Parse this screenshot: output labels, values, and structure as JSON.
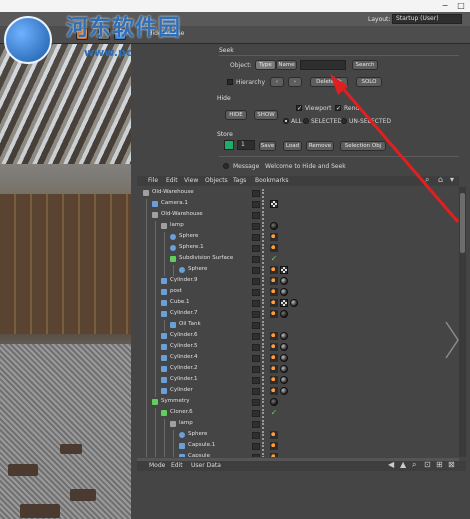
{
  "watermark": {
    "text": "河东软件园",
    "url": "www.pc0359.cn"
  },
  "window": {
    "minimize": "−",
    "maximize": "□"
  },
  "toolbar": {
    "layout_label": "Layout:",
    "layout_value": "Startup (User)",
    "scene_name": "Hide and Se"
  },
  "seek": {
    "group_title": "Seek",
    "object_label": "Object:",
    "type_tab": "Type",
    "name_tab": "Name",
    "search_button": "Search",
    "hierarchy_label": "Hierarchy",
    "prev_button": "‹",
    "next_button": "›",
    "delete_tag_button": "Delete Ta",
    "solo_button": "SOLO"
  },
  "hide": {
    "group_title": "Hide",
    "hide_button": "HIDE",
    "show_button": "SHOW",
    "viewport_label": "Viewport",
    "render_label": "Rend",
    "all_label": "ALL",
    "selected_label": "SELECTED",
    "unselected_label": "UN-SELECTED"
  },
  "store": {
    "group_title": "Store",
    "slot_value": "1",
    "save_button": "Save",
    "load_button": "Load",
    "remove_button": "Remove",
    "selection_button": "Selection Obj"
  },
  "message": {
    "label": "Message",
    "text": "Welcome to Hide and Seek"
  },
  "object_manager": {
    "menus": [
      "File",
      "Edit",
      "View",
      "Objects",
      "Tags",
      "Bookmarks"
    ],
    "rows": [
      {
        "name": "Old-Warehouse",
        "depth": 0,
        "icon": "null",
        "tags": []
      },
      {
        "name": "Camera.1",
        "depth": 1,
        "icon": "camera",
        "tags": [
          "checker"
        ]
      },
      {
        "name": "Old-Warehouse",
        "depth": 1,
        "icon": "null",
        "tags": []
      },
      {
        "name": "lamp",
        "depth": 2,
        "icon": "null",
        "tags": [
          "mat2"
        ]
      },
      {
        "name": "Sphere",
        "depth": 3,
        "icon": "sphere",
        "tags": [
          "phong"
        ]
      },
      {
        "name": "Sphere.1",
        "depth": 3,
        "icon": "sphere",
        "tags": [
          "phong"
        ]
      },
      {
        "name": "Subdivision Surface",
        "depth": 3,
        "icon": "subdiv",
        "tags": [
          "tick"
        ]
      },
      {
        "name": "Sphere",
        "depth": 4,
        "icon": "sphere-gizmo",
        "tags": [
          "phong",
          "checker"
        ]
      },
      {
        "name": "Cylinder.9",
        "depth": 2,
        "icon": "cylinder",
        "tags": [
          "phong",
          "mat"
        ]
      },
      {
        "name": "post",
        "depth": 2,
        "icon": "cylinder",
        "tags": [
          "phong",
          "mat"
        ]
      },
      {
        "name": "Cube.1",
        "depth": 2,
        "icon": "cube",
        "tags": [
          "phong",
          "checker",
          "mat"
        ]
      },
      {
        "name": "Cylinder.7",
        "depth": 2,
        "icon": "cylinder",
        "tags": [
          "phong",
          "mat2"
        ]
      },
      {
        "name": "Oil Tank",
        "depth": 3,
        "icon": "cylinder",
        "tags": []
      },
      {
        "name": "Cylinder.6",
        "depth": 2,
        "icon": "cylinder",
        "tags": [
          "phong",
          "mat"
        ]
      },
      {
        "name": "Cylinder.5",
        "depth": 2,
        "icon": "cylinder",
        "tags": [
          "phong",
          "mat"
        ]
      },
      {
        "name": "Cylinder.4",
        "depth": 2,
        "icon": "cylinder",
        "tags": [
          "phong",
          "mat"
        ]
      },
      {
        "name": "Cylinder.2",
        "depth": 2,
        "icon": "cylinder",
        "tags": [
          "phong",
          "mat"
        ]
      },
      {
        "name": "Cylinder.1",
        "depth": 2,
        "icon": "cylinder",
        "tags": [
          "phong",
          "mat"
        ]
      },
      {
        "name": "Cylinder",
        "depth": 2,
        "icon": "cylinder",
        "tags": [
          "phong",
          "mat"
        ]
      },
      {
        "name": "Symmetry",
        "depth": 1,
        "icon": "symmetry",
        "tags": [
          "mat2"
        ]
      },
      {
        "name": "Cloner.6",
        "depth": 2,
        "icon": "cloner",
        "tags": [
          "tick"
        ]
      },
      {
        "name": "lamp",
        "depth": 3,
        "icon": "null",
        "tags": []
      },
      {
        "name": "Sphere",
        "depth": 4,
        "icon": "sphere",
        "tags": [
          "phong"
        ]
      },
      {
        "name": "Capsule.1",
        "depth": 4,
        "icon": "capsule",
        "tags": [
          "phong"
        ]
      },
      {
        "name": "Capsule",
        "depth": 4,
        "icon": "capsule",
        "tags": [
          "phong"
        ]
      }
    ]
  },
  "attribute_manager": {
    "menus": [
      "Mode",
      "Edit",
      "User Data"
    ]
  },
  "colors": {
    "panel": "#454545",
    "accent_green": "#1fae6a",
    "arrow_red": "#e02020",
    "phong_orange": "#ff9b3a"
  }
}
